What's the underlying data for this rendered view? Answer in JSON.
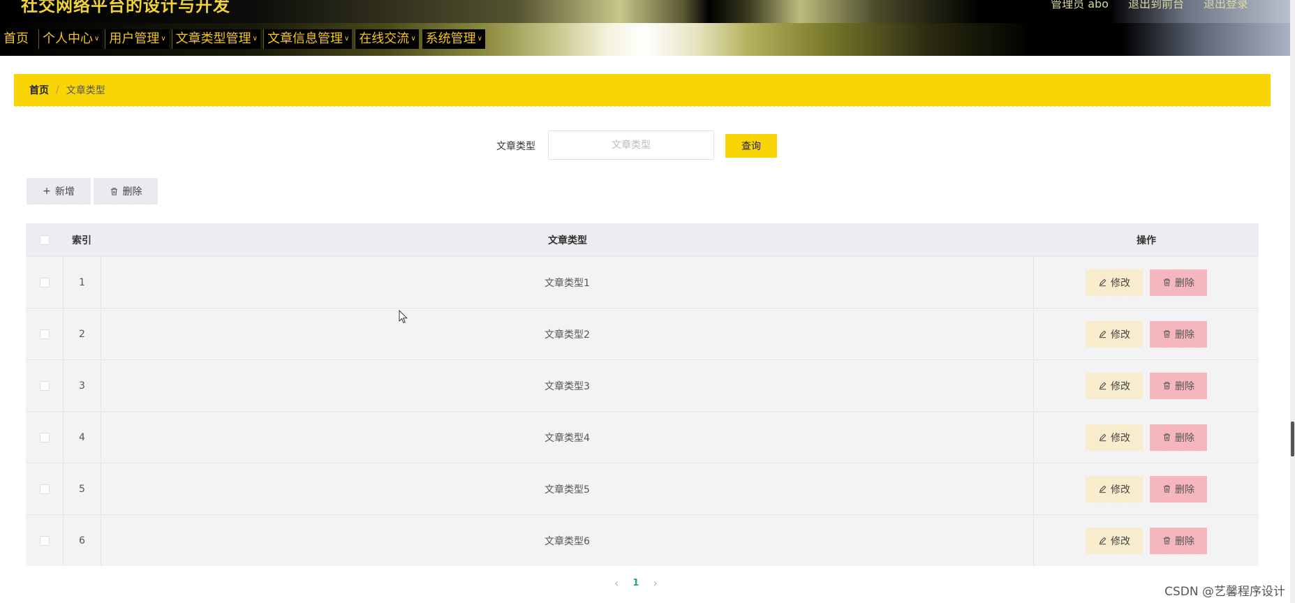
{
  "header": {
    "site_title": "社交网络平台的设计与开发",
    "top_links": [
      "管理员 abo",
      "退出到前台",
      "退出登录"
    ]
  },
  "nav": {
    "items": [
      {
        "label": "首页",
        "has_caret": false
      },
      {
        "label": "个人中心",
        "has_caret": true
      },
      {
        "label": "用户管理",
        "has_caret": true
      },
      {
        "label": "文章类型管理",
        "has_caret": true
      },
      {
        "label": "文章信息管理",
        "has_caret": true
      },
      {
        "label": "在线交流",
        "has_caret": true
      },
      {
        "label": "系统管理",
        "has_caret": true
      }
    ]
  },
  "breadcrumb": {
    "home": "首页",
    "separator": "/",
    "current": "文章类型"
  },
  "search": {
    "label": "文章类型",
    "placeholder": "文章类型",
    "value": "",
    "button": "查询"
  },
  "toolbar": {
    "add_label": "新增",
    "delete_label": "删除"
  },
  "table": {
    "columns": {
      "index": "索引",
      "type": "文章类型",
      "ops": "操作"
    },
    "rows": [
      {
        "index": "1",
        "type": "文章类型1"
      },
      {
        "index": "2",
        "type": "文章类型2"
      },
      {
        "index": "3",
        "type": "文章类型3"
      },
      {
        "index": "4",
        "type": "文章类型4"
      },
      {
        "index": "5",
        "type": "文章类型5"
      },
      {
        "index": "6",
        "type": "文章类型6"
      }
    ],
    "edit_label": "修改",
    "delete_label": "删除"
  },
  "pagination": {
    "current": "1",
    "prev": "‹",
    "next": "›"
  },
  "watermark": "CSDN @艺馨程序设计",
  "colors": {
    "accent": "#fad506",
    "nav_text": "#f5c518",
    "edit_btn": "#f7eccc",
    "delete_btn": "#f5b6bd",
    "page_active": "#1ea87a"
  }
}
